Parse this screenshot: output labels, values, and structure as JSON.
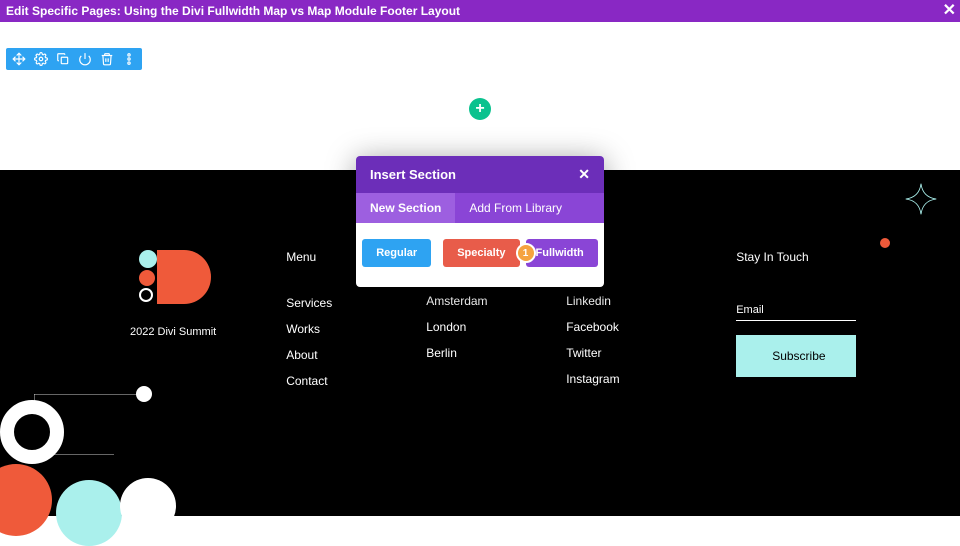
{
  "titleBar": {
    "title": "Edit Specific Pages: Using the Divi Fullwidth Map vs Map Module Footer Layout"
  },
  "modal": {
    "title": "Insert Section",
    "tabs": {
      "new": "New Section",
      "library": "Add From Library"
    },
    "buttons": {
      "regular": "Regular",
      "specialty": "Specialty",
      "fullwidth": "Fullwidth"
    },
    "badge_number": "1"
  },
  "footer": {
    "logo_caption": "2022 Divi Summit",
    "menu_title": "Menu",
    "menu": [
      "Services",
      "Works",
      "About",
      "Contact"
    ],
    "locations": [
      "Amsterdam",
      "London",
      "Berlin"
    ],
    "socials": [
      "Linkedin",
      "Facebook",
      "Twitter",
      "Instagram"
    ],
    "stay_title": "Stay In Touch",
    "email_label": "Email",
    "subscribe_label": "Subscribe"
  },
  "buttons": {
    "add_plus": "+"
  }
}
